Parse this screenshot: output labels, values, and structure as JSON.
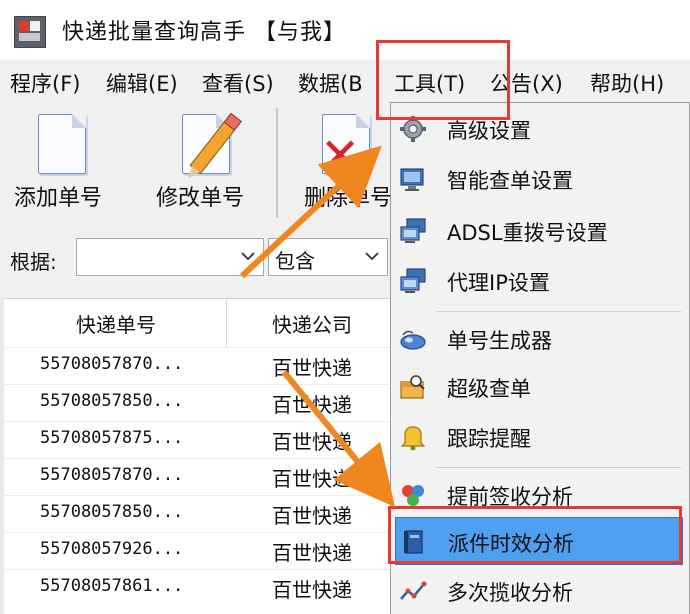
{
  "window": {
    "title": "快递批量查询高手 【与我】"
  },
  "menu": {
    "items": [
      "程序(F)",
      "编辑(E)",
      "查看(S)",
      "数据(B",
      "工具(T)",
      "公告(X)",
      "帮助(H)"
    ]
  },
  "toolbar": {
    "add_label": "添加单号",
    "edit_label": "修改单号",
    "delete_label": "删除单号"
  },
  "filter": {
    "label": "根据:",
    "field_value": "",
    "match_value": "包含"
  },
  "table": {
    "headers": [
      "快递单号",
      "快递公司"
    ],
    "rows": [
      [
        "55708057870...",
        "百世快递"
      ],
      [
        "55708057850...",
        "百世快递"
      ],
      [
        "55708057875...",
        "百世快递"
      ],
      [
        "55708057870...",
        "百世快递"
      ],
      [
        "55708057850...",
        "百世快递"
      ],
      [
        "55708057926...",
        "百世快递"
      ],
      [
        "55708057861...",
        "百世快递"
      ]
    ]
  },
  "tools_menu": {
    "items": [
      {
        "label": "高级设置",
        "icon": "gear-icon"
      },
      {
        "label": "智能查单设置",
        "icon": "monitor-icon"
      },
      {
        "label": "ADSL重拨号设置",
        "icon": "network-icon"
      },
      {
        "label": "代理IP设置",
        "icon": "proxy-icon"
      },
      {
        "label": "单号生成器",
        "icon": "mouse-icon"
      },
      {
        "label": "超级查单",
        "icon": "box-search-icon"
      },
      {
        "label": "跟踪提醒",
        "icon": "bell-icon"
      },
      {
        "label": "提前签收分析",
        "icon": "cube-icon"
      },
      {
        "label": "派件时效分析",
        "icon": "book-icon"
      },
      {
        "label": "多次揽收分析",
        "icon": "chart-line-icon"
      }
    ],
    "highlighted_index": 8
  },
  "colors": {
    "highlight": "#4d9ff0",
    "annotation": "#e53935",
    "arrow": "#f0861f"
  }
}
